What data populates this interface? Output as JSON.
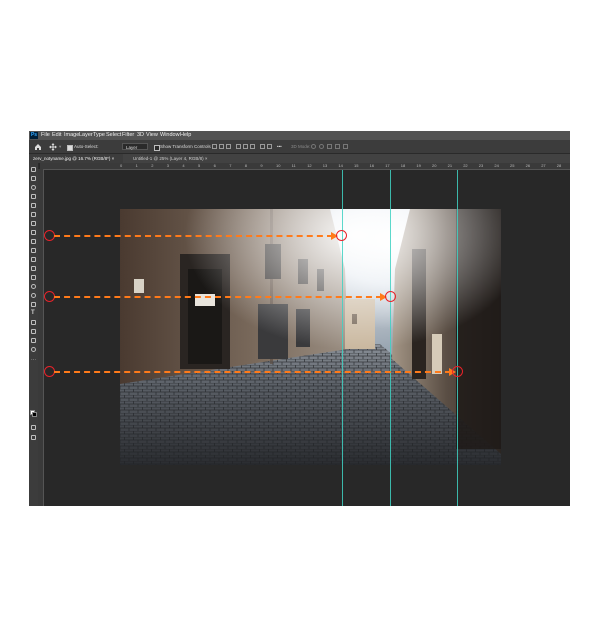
{
  "app": {
    "logo": "Ps"
  },
  "menu": [
    "File",
    "Edit",
    "Image",
    "Layer",
    "Type",
    "Select",
    "Filter",
    "3D",
    "View",
    "Window",
    "Help"
  ],
  "options_bar": {
    "auto_select_label": "Auto-Select:",
    "layer_select": "Layer",
    "transform_controls_label": "Show Transform Controls",
    "mode_3d": "3D Mode:"
  },
  "tabs": [
    {
      "label": "zerv_notyname.jpg @ 16.7% (RGB/8*) ×"
    },
    {
      "label": "Untitled-1 @ 25% (Layer 4, RGB/8) ×"
    }
  ],
  "ruler_ticks": [
    "0",
    "1",
    "2",
    "3",
    "4",
    "5",
    "6",
    "7",
    "8",
    "9",
    "10",
    "11",
    "12",
    "13",
    "14",
    "15",
    "16",
    "17",
    "18",
    "19",
    "20",
    "21",
    "22",
    "23",
    "24",
    "25",
    "26",
    "27",
    "28"
  ],
  "icons": {
    "home": "home-icon",
    "move": "move-icon",
    "tools": [
      "move-tool-icon",
      "marquee-tool-icon",
      "lasso-tool-icon",
      "quick-select-tool-icon",
      "crop-tool-icon",
      "frame-tool-icon",
      "eyedropper-tool-icon",
      "healing-tool-icon",
      "brush-tool-icon",
      "stamp-tool-icon",
      "history-brush-tool-icon",
      "eraser-tool-icon",
      "gradient-tool-icon",
      "blur-tool-icon",
      "dodge-tool-icon",
      "pen-tool-icon",
      "type-tool-icon",
      "path-select-tool-icon",
      "shape-tool-icon",
      "hand-tool-icon",
      "zoom-tool-icon",
      "more-tools-icon"
    ]
  },
  "colors": {
    "guide": "#3fd1c2",
    "arrow": "#ff7a1a",
    "marker_ring": "#e8232a",
    "workspace": "#282828"
  }
}
